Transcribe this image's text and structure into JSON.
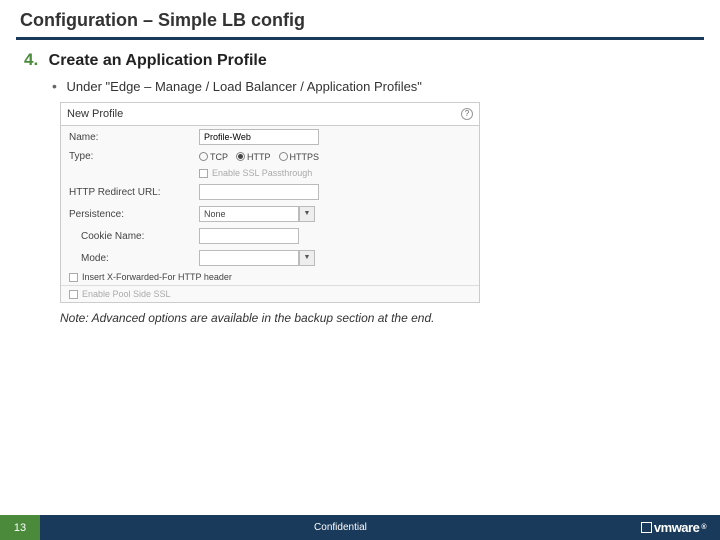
{
  "slide": {
    "title": "Configuration – Simple LB config",
    "step_number": "4.",
    "step_title": "Create an Application Profile",
    "bullet_text": "Under \"Edge – Manage /  Load Balancer / Application Profiles\"",
    "note": "Note: Advanced options are available in the backup section at the end."
  },
  "dialog": {
    "header": "New Profile",
    "name_label": "Name:",
    "name_value": "Profile-Web",
    "type_label": "Type:",
    "type_tcp": "TCP",
    "type_http": "HTTP",
    "type_https": "HTTPS",
    "ssl_passthrough": "Enable SSL Passthrough",
    "redirect_label": "HTTP Redirect URL:",
    "persistence_label": "Persistence:",
    "persistence_value": "None",
    "cookie_label": "Cookie Name:",
    "mode_label": "Mode:",
    "xff_label": "Insert X-Forwarded-For HTTP header",
    "pool_ssl": "Enable Pool Side SSL"
  },
  "footer": {
    "page": "13",
    "confidential": "Confidential",
    "logo_text": "vmware"
  }
}
